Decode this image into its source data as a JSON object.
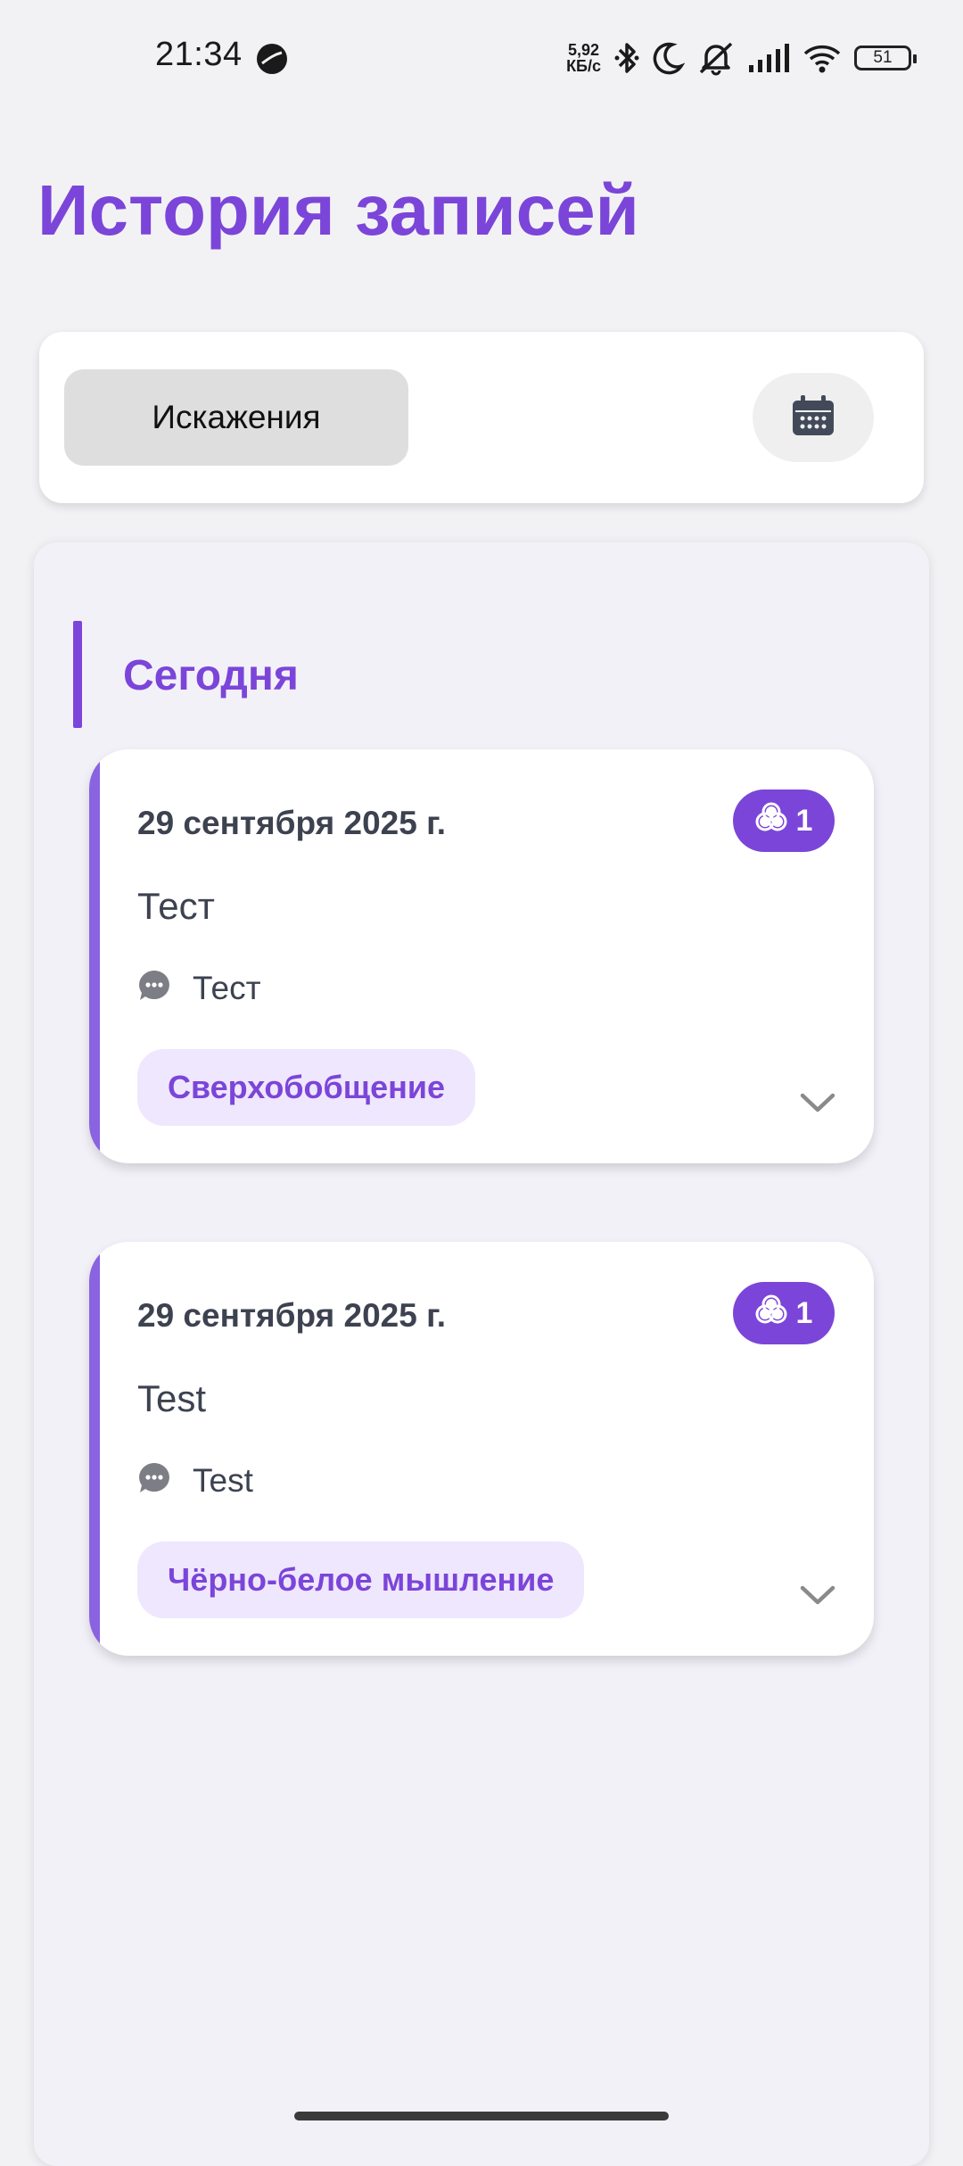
{
  "status_bar": {
    "time": "21:34",
    "net_speed_value": "5,92",
    "net_speed_unit": "КБ/с",
    "battery": "51",
    "icons": [
      "bluetooth-icon",
      "moon-icon",
      "bell-off-icon",
      "signal-icon",
      "wifi-icon",
      "battery-icon"
    ]
  },
  "header": {
    "title": "История записей"
  },
  "filter": {
    "chip_label": "Искажения",
    "calendar_icon": "calendar-icon"
  },
  "section": {
    "title": "Сегодня"
  },
  "entries": [
    {
      "date": "29 сентября 2025 г.",
      "count": "1",
      "title": "Тест",
      "comment": "Тест",
      "tag": "Сверхобобщение"
    },
    {
      "date": "29 сентября 2025 г.",
      "count": "1",
      "title": "Test",
      "comment": "Test",
      "tag": "Чёрно-белое мышление"
    }
  ],
  "colors": {
    "accent": "#7b45d9",
    "tag_background": "#efe7fd",
    "text_primary": "#3d4250",
    "background": "#f2f2f4"
  }
}
